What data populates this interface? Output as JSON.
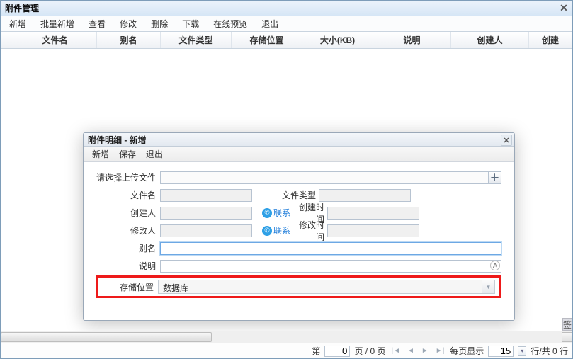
{
  "window": {
    "title": "附件管理"
  },
  "toolbar": {
    "new": "新增",
    "batch_new": "批量新增",
    "view": "查看",
    "edit": "修改",
    "delete": "删除",
    "download": "下载",
    "preview": "在线预览",
    "exit": "退出"
  },
  "columns": {
    "filename": "文件名",
    "alias": "别名",
    "filetype": "文件类型",
    "storage": "存储位置",
    "size_kb": "大小(KB)",
    "desc": "说明",
    "creator": "创建人",
    "create_time": "创建"
  },
  "side_tab_label": "签",
  "pagination": {
    "label_page": "第",
    "current": "0",
    "sep": "页 / 0 页",
    "per_page_label": "每页显示",
    "per_page_value": "15",
    "rows_label": "行/共 0 行"
  },
  "dialog": {
    "title": "附件明细 - 新增",
    "toolbar": {
      "new": "新增",
      "save": "保存",
      "exit": "退出"
    },
    "labels": {
      "choose_file": "请选择上传文件",
      "filename": "文件名",
      "filetype": "文件类型",
      "creator": "创建人",
      "create_time": "创建时间",
      "modifier": "修改人",
      "modify_time": "修改时间",
      "alias": "别名",
      "desc": "说明",
      "storage": "存储位置",
      "contact": "联系"
    },
    "values": {
      "storage": "数据库",
      "alias": "",
      "desc": ""
    }
  }
}
